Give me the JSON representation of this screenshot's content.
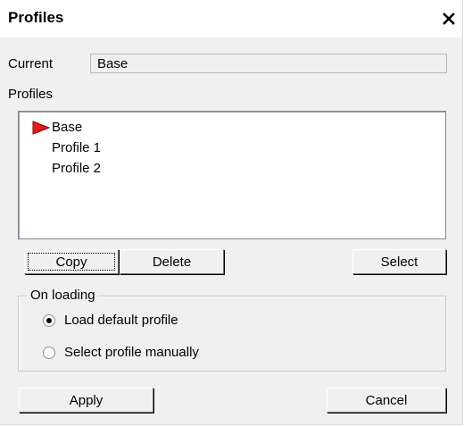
{
  "window": {
    "title": "Profiles",
    "close_glyph": "×"
  },
  "current": {
    "label": "Current",
    "value": "Base"
  },
  "profiles": {
    "label": "Profiles",
    "items": [
      {
        "label": "Base",
        "active": true
      },
      {
        "label": "Profile 1",
        "active": false
      },
      {
        "label": "Profile 2",
        "active": false
      }
    ],
    "active_marker_color": "#e31b1b"
  },
  "buttons": {
    "copy": "Copy",
    "delete": "Delete",
    "select": "Select",
    "apply": "Apply",
    "cancel": "Cancel"
  },
  "on_loading": {
    "legend": "On loading",
    "options": [
      {
        "label": "Load default profile",
        "checked": true
      },
      {
        "label": "Select profile manually",
        "checked": false
      }
    ]
  }
}
